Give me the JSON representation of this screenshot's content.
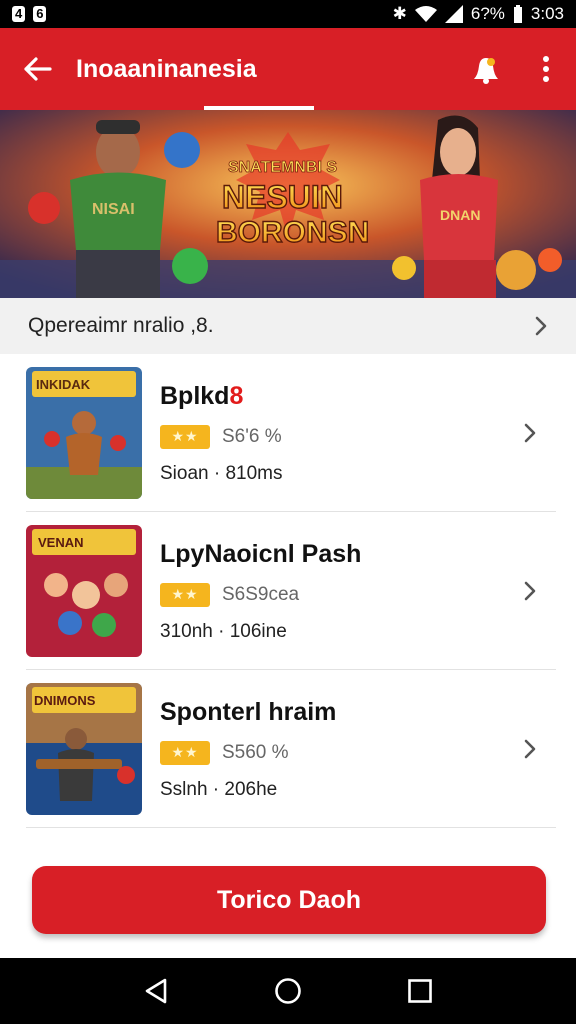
{
  "status": {
    "left_icons": [
      "4",
      "6"
    ],
    "battery_text": "6?%",
    "time": "3:03"
  },
  "appbar": {
    "title": "Inoaaninanesia"
  },
  "banner": {
    "title_line1": "SNATEMNBI S",
    "title_line2": "NESUIN",
    "title_line3": "BORONSN",
    "left_char_shirt": "NISAI",
    "right_char_shirt": "DNAN"
  },
  "section": {
    "label": "Qpereaimr nralio ,8."
  },
  "items": [
    {
      "name": "Bplkd",
      "badge": "8",
      "rating": "S6'6 %",
      "meta": "Sioan · 810ms",
      "thumb_text": "INKIDAK"
    },
    {
      "name": "LpyNaoicnl Pash",
      "badge": "",
      "rating": "S6S9cea",
      "meta": "310nh · 106ine",
      "thumb_text": "VENAN"
    },
    {
      "name": "Sponterl hraim",
      "badge": "",
      "rating": "S560 %",
      "meta": "Sslnh · 206he",
      "thumb_text": "DNIMONS"
    }
  ],
  "cta": {
    "label": "Torico Daoh"
  },
  "colors": {
    "brand_red": "#d81f26",
    "star_gold": "#f5b51e"
  }
}
